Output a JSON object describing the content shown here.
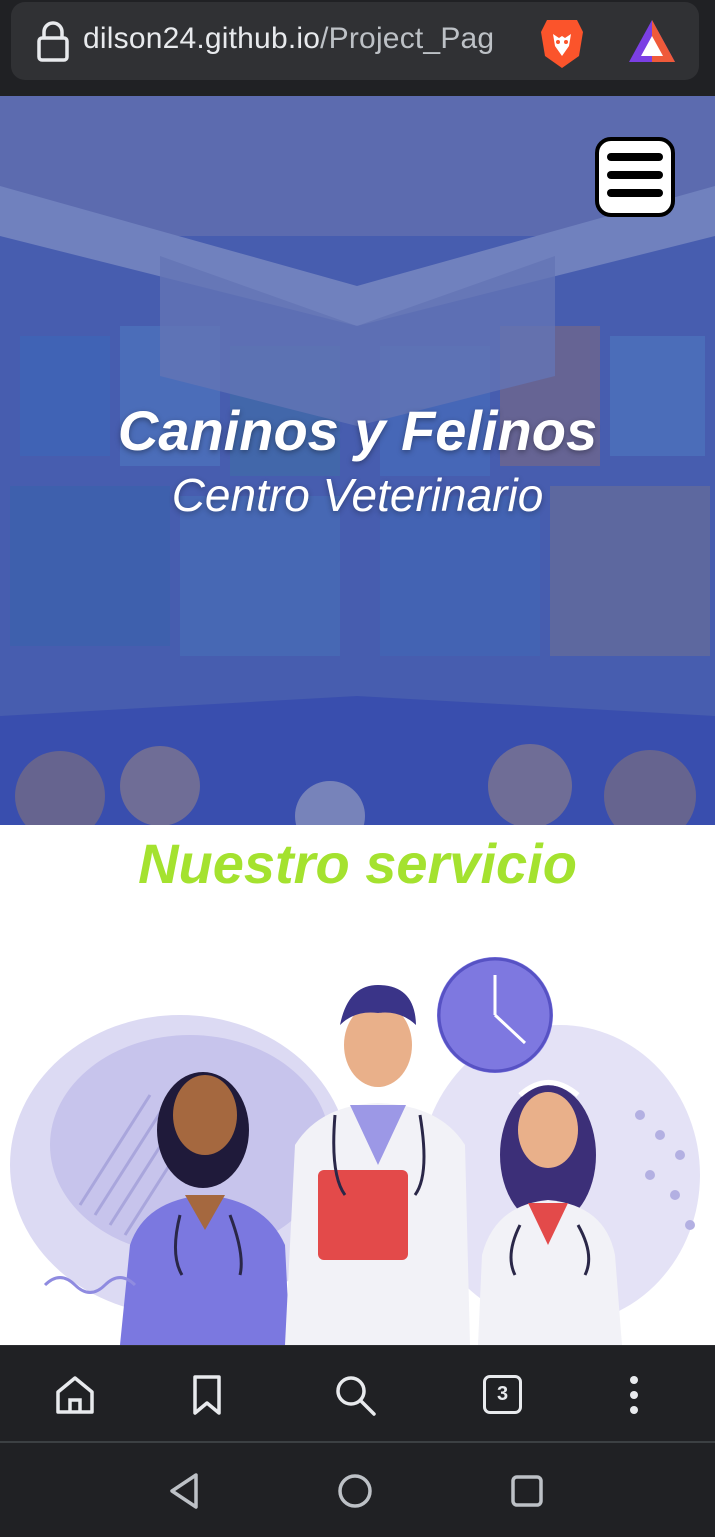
{
  "browser": {
    "url_host": "dilson24.github.io",
    "url_path": "/Project_Pag",
    "tab_count": "3",
    "icons": [
      "lock-icon",
      "brave-lion-icon",
      "brave-rewards-icon",
      "home-icon",
      "bookmark-icon",
      "search-icon",
      "tabs-icon",
      "more-icon"
    ]
  },
  "hero": {
    "title": "Caninos y Felinos",
    "subtitle": "Centro Veterinario"
  },
  "services": {
    "title": "Nuestro servicio"
  },
  "navbar": {
    "icons": [
      "back-icon",
      "home-circle-icon",
      "recents-icon"
    ]
  },
  "colors": {
    "accent_green": "#a4e22f",
    "hero_tint": "#3f5fb0",
    "browser_dark": "#202124"
  }
}
